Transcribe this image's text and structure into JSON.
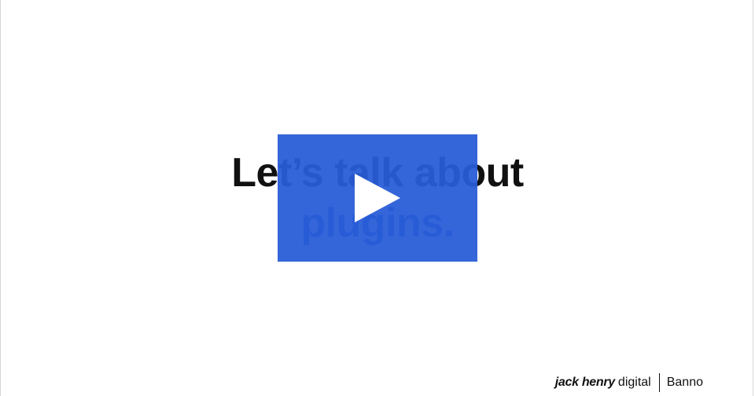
{
  "slide": {
    "headline_line1": "Let’s talk about",
    "headline_line2": "plugins."
  },
  "video": {
    "play_button_icon": "play-icon",
    "overlay_color": "#2d5fd8"
  },
  "footer": {
    "brand_bold": "jack henry",
    "brand_light": "digital",
    "product": "Banno"
  },
  "colors": {
    "headline_primary": "#111111",
    "headline_accent": "#2a56d0",
    "play_overlay": "#2d5fd8",
    "background": "#ffffff"
  }
}
